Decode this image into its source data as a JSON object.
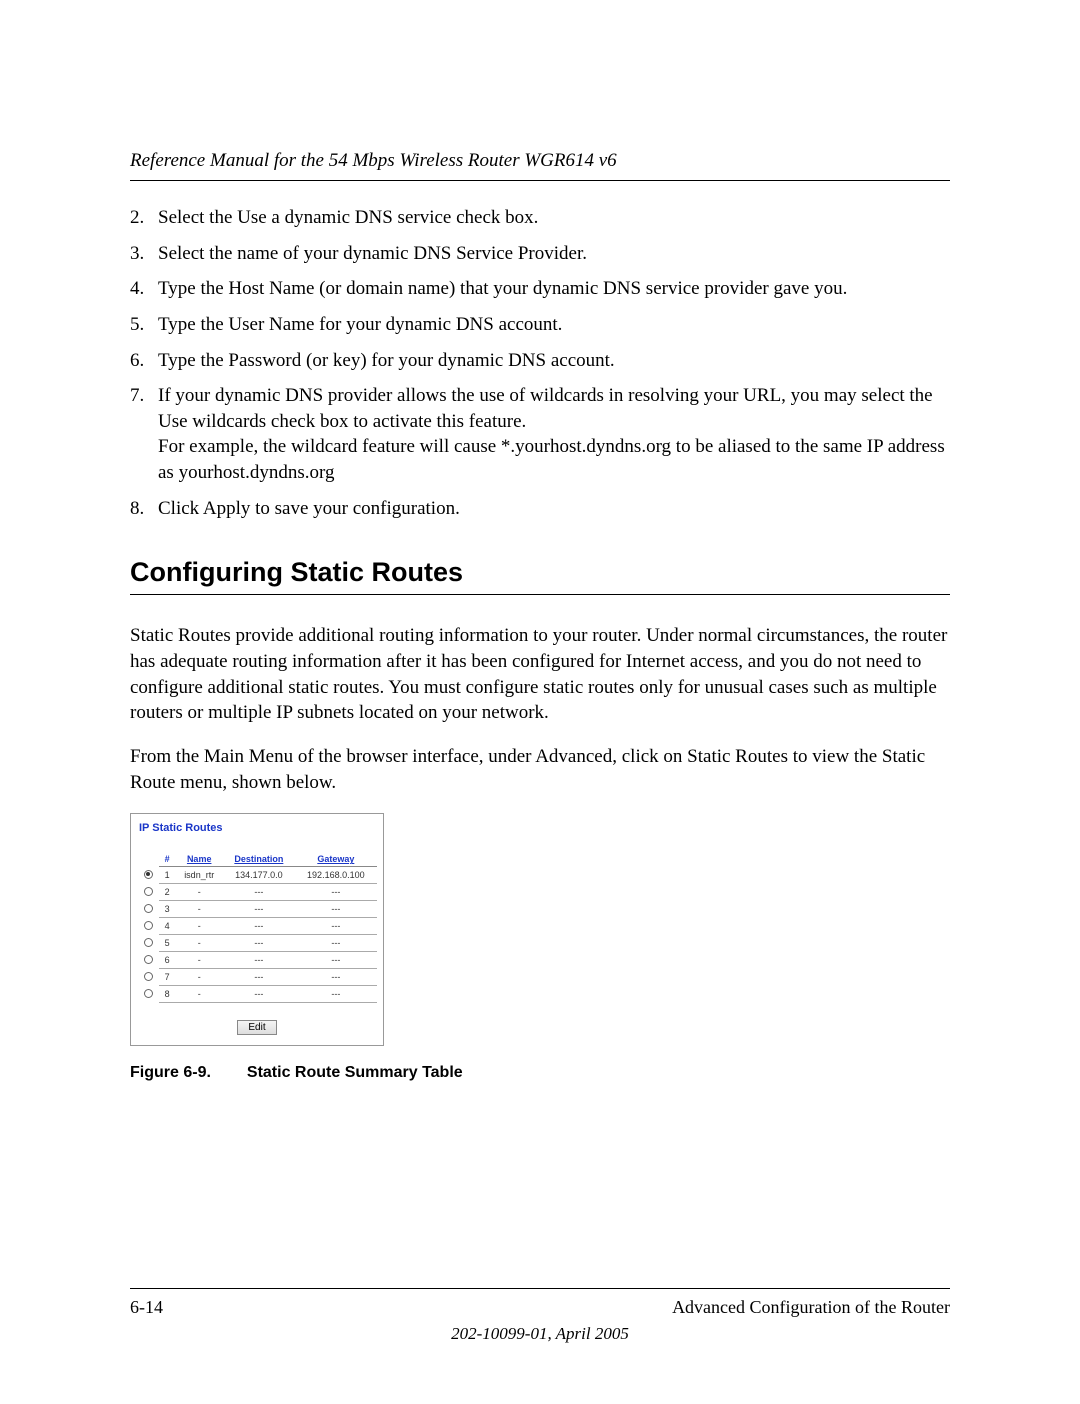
{
  "header": {
    "title": "Reference Manual for the 54 Mbps Wireless Router WGR614 v6"
  },
  "steps": [
    "Select the Use a dynamic DNS service check box.",
    "Select the name of your dynamic DNS Service Provider.",
    "Type the Host Name (or domain name) that your dynamic DNS service provider gave you.",
    "Type the User Name for your dynamic DNS account.",
    "Type the Password (or key) for your dynamic DNS account.",
    "If your dynamic DNS provider allows the use of wildcards in resolving your URL, you may select the Use wildcards check box to activate this feature.\nFor example, the wildcard feature will cause *.yourhost.dyndns.org to be aliased to the same IP address as yourhost.dyndns.org",
    "Click Apply to save your configuration."
  ],
  "section": {
    "heading": "Configuring Static Routes",
    "para1": "Static Routes provide additional routing information to your router. Under normal circumstances, the router has adequate routing information after it has been configured for Internet access, and you do not need to configure additional static routes. You must configure static routes only for unusual cases such as multiple routers or multiple IP subnets located on your network.",
    "para2": "From the Main Menu of the browser interface, under Advanced, click on Static Routes to view the Static Route menu, shown below."
  },
  "figure": {
    "title": "IP Static Routes",
    "columns": {
      "hash": "#",
      "name": "Name",
      "dest": "Destination",
      "gw": "Gateway"
    },
    "rows": [
      {
        "selected": true,
        "idx": "1",
        "name": "isdn_rtr",
        "dest": "134.177.0.0",
        "gw": "192.168.0.100"
      },
      {
        "selected": false,
        "idx": "2",
        "name": "-",
        "dest": "---",
        "gw": "---"
      },
      {
        "selected": false,
        "idx": "3",
        "name": "-",
        "dest": "---",
        "gw": "---"
      },
      {
        "selected": false,
        "idx": "4",
        "name": "-",
        "dest": "---",
        "gw": "---"
      },
      {
        "selected": false,
        "idx": "5",
        "name": "-",
        "dest": "---",
        "gw": "---"
      },
      {
        "selected": false,
        "idx": "6",
        "name": "-",
        "dest": "---",
        "gw": "---"
      },
      {
        "selected": false,
        "idx": "7",
        "name": "-",
        "dest": "---",
        "gw": "---"
      },
      {
        "selected": false,
        "idx": "8",
        "name": "-",
        "dest": "---",
        "gw": "---"
      }
    ],
    "edit_label": "Edit",
    "caption_prefix": "Figure 6-9.",
    "caption_text": "Static Route Summary Table"
  },
  "footer": {
    "page": "6-14",
    "section_name": "Advanced Configuration of the Router",
    "doc_id": "202-10099-01, April 2005"
  }
}
